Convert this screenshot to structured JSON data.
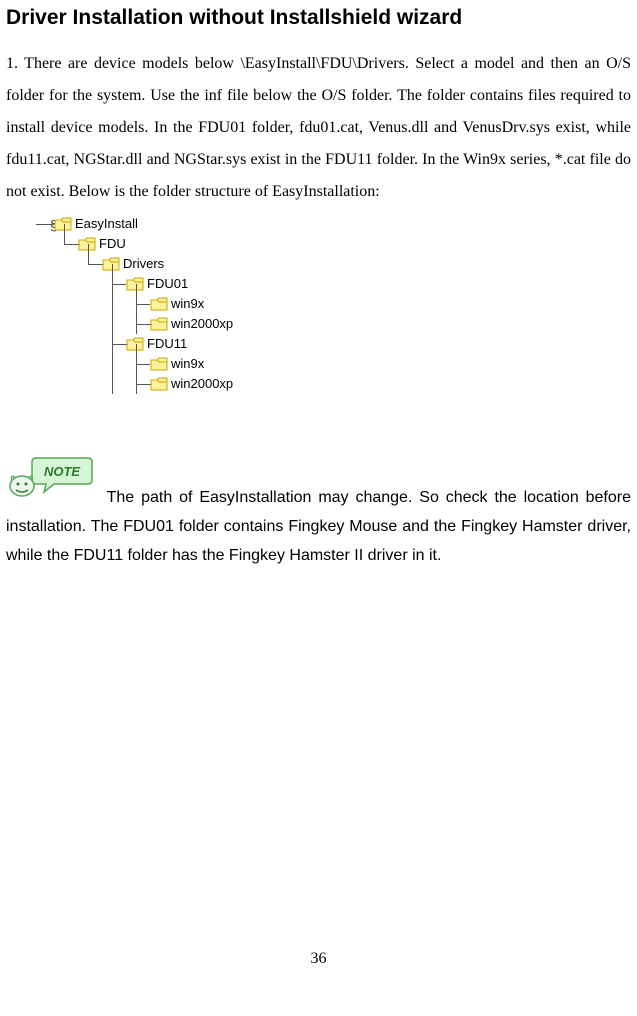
{
  "title": "Driver Installation without Installshield wizard",
  "paragraph1": "1. There are device models below \\EasyInstall\\FDU\\Drivers. Select a model and then an O/S folder for the system. Use the inf file below the O/S folder. The folder contains files required to install device models. In the FDU01 folder, fdu01.cat, Venus.dll and VenusDrv.sys exist, while fdu11.cat, NGStar.dll and NGStar.sys exist in the FDU11 folder. In the Win9x series, *.cat file do not exist. Below is the folder structure of EasyInstallation:",
  "tree": {
    "n0": "EasyInstall",
    "n1": "FDU",
    "n2": "Drivers",
    "n3": "FDU01",
    "n4": "win9x",
    "n5": "win2000xp",
    "n6": "FDU11",
    "n7": "win9x",
    "n8": "win2000xp"
  },
  "note": "The path of EasyInstallation may change. So check the location before installation. The FDU01 folder contains Fingkey Mouse and the Fingkey Hamster driver, while the FDU11 folder has the Fingkey Hamster II driver in it.",
  "page_number": "36"
}
